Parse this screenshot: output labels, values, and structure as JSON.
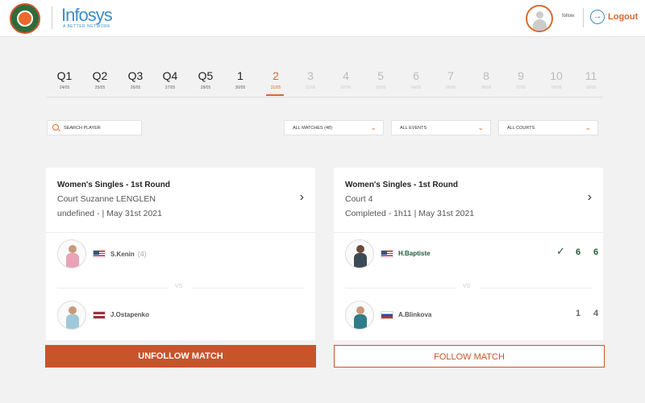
{
  "header": {
    "brand": "Infosys",
    "brand_sub": "A BETTER NETWORK",
    "username": "follow",
    "logout": "Logout"
  },
  "days": [
    {
      "label": "Q1",
      "date": "24/05",
      "state": "past"
    },
    {
      "label": "Q2",
      "date": "25/05",
      "state": "past"
    },
    {
      "label": "Q3",
      "date": "26/05",
      "state": "past"
    },
    {
      "label": "Q4",
      "date": "27/05",
      "state": "past"
    },
    {
      "label": "Q5",
      "date": "28/05",
      "state": "past"
    },
    {
      "label": "1",
      "date": "30/05",
      "state": "past"
    },
    {
      "label": "2",
      "date": "31/05",
      "state": "active"
    },
    {
      "label": "3",
      "date": "01/06",
      "state": "future"
    },
    {
      "label": "4",
      "date": "02/06",
      "state": "future"
    },
    {
      "label": "5",
      "date": "03/06",
      "state": "future"
    },
    {
      "label": "6",
      "date": "04/06",
      "state": "future"
    },
    {
      "label": "7",
      "date": "05/06",
      "state": "future"
    },
    {
      "label": "8",
      "date": "06/06",
      "state": "future"
    },
    {
      "label": "9",
      "date": "07/06",
      "state": "future"
    },
    {
      "label": "10",
      "date": "08/06",
      "state": "future"
    },
    {
      "label": "11",
      "date": "09/06",
      "state": "future"
    }
  ],
  "filters": {
    "search_placeholder": "SEARCH PLAYER",
    "matches": "ALL MATCHES (48)",
    "events": "ALL EVENTS",
    "courts": "ALL COURTS"
  },
  "matches": [
    {
      "title": "Women's Singles - 1st Round",
      "court": "Court Suzanne LENGLEN",
      "status": "undefined - | May 31st 2021",
      "player1": {
        "name": "S.Kenin",
        "seed": "(4)"
      },
      "player2": {
        "name": "J.Ostapenko"
      },
      "vs": "VS",
      "button": "UNFOLLOW MATCH"
    },
    {
      "title": "Women's Singles - 1st Round",
      "court": "Court 4",
      "status": "Completed - 1h11 | May 31st 2021",
      "player1": {
        "name": "H.Baptiste",
        "scores": [
          "6",
          "6"
        ]
      },
      "player2": {
        "name": "A.Blinkova",
        "scores": [
          "1",
          "4"
        ]
      },
      "vs": "VS",
      "button": "FOLLOW MATCH"
    }
  ],
  "colors": {
    "accent": "#c8542a",
    "winner": "#1e5c3a",
    "brand": "#3b8fc9"
  }
}
